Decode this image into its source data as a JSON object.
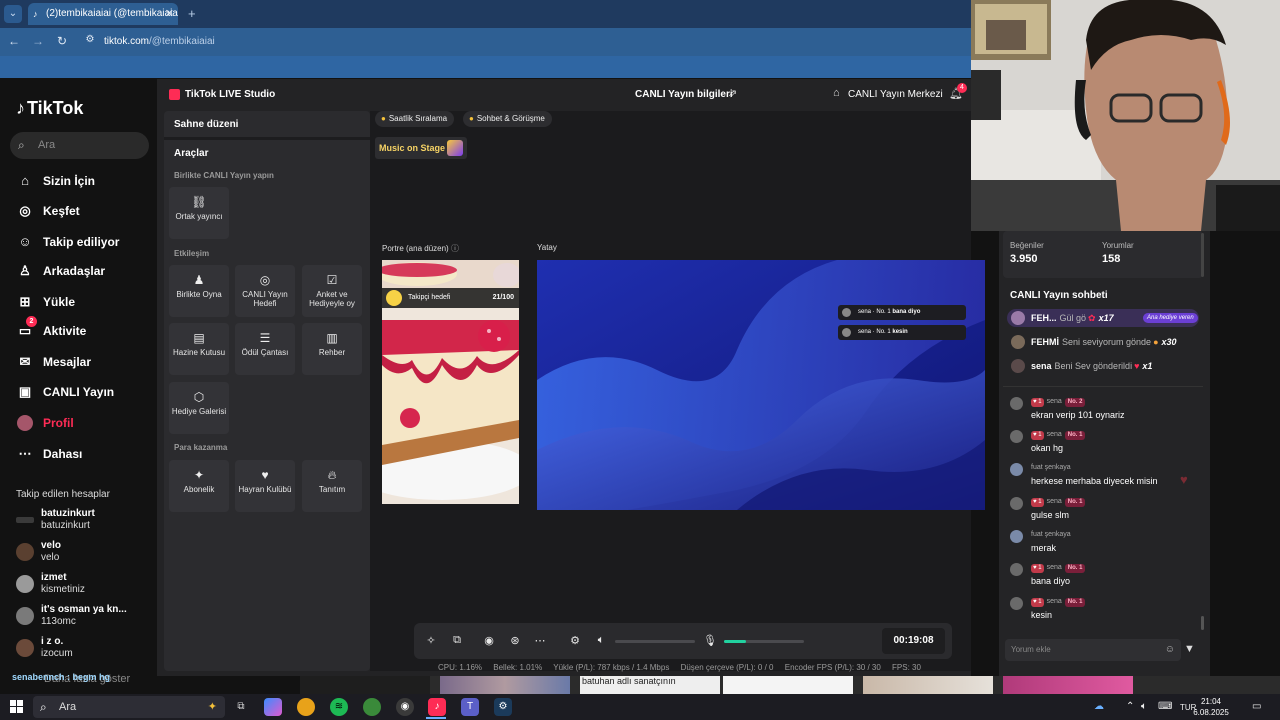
{
  "browser": {
    "tab_title": "(2)tembikaiaiai (@tembikaiaia",
    "tab_close": "✕",
    "new_tab": "+",
    "url_host": "tiktok.com",
    "url_path": "/@tembikaiaiai"
  },
  "tiktok": {
    "logo": "TikTok",
    "search_placeholder": "Ara",
    "nav": [
      {
        "label": "Sizin İçin",
        "icon": "home-icon"
      },
      {
        "label": "Keşfet",
        "icon": "compass-icon"
      },
      {
        "label": "Takip ediliyor",
        "icon": "following-icon"
      },
      {
        "label": "Arkadaşlar",
        "icon": "friends-icon"
      },
      {
        "label": "Yükle",
        "icon": "upload-icon"
      },
      {
        "label": "Aktivite",
        "icon": "activity-icon",
        "badge": "2"
      },
      {
        "label": "Mesajlar",
        "icon": "messages-icon"
      },
      {
        "label": "CANLI Yayın",
        "icon": "live-icon"
      },
      {
        "label": "Profil",
        "icon": "profile-icon",
        "active": true
      },
      {
        "label": "Dahası",
        "icon": "more-icon"
      }
    ],
    "following_header": "Takip edilen hesaplar",
    "following": [
      {
        "name": "batuzinkurt",
        "handle": "batuzinkurt"
      },
      {
        "name": "velo",
        "handle": "velo"
      },
      {
        "name": "izmet",
        "handle": "kismetiniz"
      },
      {
        "name": "it's osman ya kn...",
        "handle": "113omc"
      },
      {
        "name": "i z o.",
        "handle": "izocum"
      }
    ],
    "show_more": "Daha fazla göster",
    "ticker": "senabennch : begm hg"
  },
  "studio": {
    "title": "TikTok LIVE Studio",
    "live_info": "CANLI Yayın bilgileri",
    "live_center": "CANLI Yayın Merkezi",
    "notif_count": "4",
    "scene_title": "Sahne düzeni",
    "tools_title": "Araçlar",
    "sections": {
      "together": "Birlikte CANLI Yayın yapın",
      "engagement": "Etkileşim",
      "earn": "Para kazanma"
    },
    "tools_together": [
      {
        "label": "Ortak yayıncı",
        "icon": "link-icon"
      }
    ],
    "tools_engagement": [
      {
        "label": "Birlikte Oyna",
        "icon": "joystick-icon"
      },
      {
        "label": "CANLI Yayın Hedefi",
        "icon": "target-icon"
      },
      {
        "label": "Anket ve Hediyeyle oy",
        "icon": "poll-icon"
      },
      {
        "label": "Hazine Kutusu",
        "icon": "treasure-icon"
      },
      {
        "label": "Ödül Çantası",
        "icon": "bag-icon"
      },
      {
        "label": "Rehber",
        "icon": "guide-icon"
      },
      {
        "label": "Hediye Galerisi",
        "icon": "gift-gallery-icon"
      }
    ],
    "tools_earn": [
      {
        "label": "Abonelik",
        "icon": "subscription-icon"
      },
      {
        "label": "Hayran Kulübü",
        "icon": "fanclub-icon"
      },
      {
        "label": "Tanıtım",
        "icon": "promote-icon"
      }
    ],
    "pills": [
      "Saatlik Sıralama",
      "Sohbet & Görüşme"
    ],
    "music_on_stage": "Music on Stage",
    "portrait_label": "Portre (ana düzen)",
    "landscape_label": "Yatay",
    "goal_label": "Takipçi hedefi",
    "goal_count": "21/100",
    "overlay_msgs": [
      {
        "user": "sena",
        "badge": "No. 1",
        "text": "bana diyo"
      },
      {
        "user": "sena",
        "badge": "No. 1",
        "text": "kesin"
      }
    ],
    "timer": "00:19:08",
    "mic_level": 0.28,
    "stats": {
      "cpu": "CPU:  1.16%",
      "memory": "Bellek:  1.01%",
      "upload": "Yükle (P/L):  787 kbps / 1.4 Mbps",
      "dropped": "Düşen çerçeve (P/L):  0 / 0",
      "encoder": "Encoder FPS (P/L):  30 / 30",
      "fps": "FPS:  30"
    }
  },
  "chat": {
    "likes_label": "Beğeniler",
    "likes_value": "3.950",
    "comments_label": "Yorumlar",
    "comments_value": "158",
    "title": "CANLI Yayın sohbeti",
    "gifts": [
      {
        "user": "FEH...",
        "text": "Gül gö",
        "count": "x17",
        "tag": "Ana hediye veren"
      },
      {
        "user": "FEHMİ",
        "text": "Seni seviyorum gönde",
        "count": "x30"
      },
      {
        "user": "sena",
        "text": "Beni Sev gönderildi",
        "count": "x1"
      }
    ],
    "messages": [
      {
        "user": "sena",
        "level": "1",
        "badge": "No. 2",
        "text": "ekran verip 101 oynariz"
      },
      {
        "user": "sena",
        "level": "1",
        "badge": "No. 1",
        "text": "okan hg"
      },
      {
        "user": "fuat şenkaya",
        "text": "herkese merhaba diyecek misin"
      },
      {
        "user": "sena",
        "level": "1",
        "badge": "No. 1",
        "text": "gulse slm"
      },
      {
        "user": "fuat şenkaya",
        "text": "merak"
      },
      {
        "user": "sena",
        "level": "1",
        "badge": "No. 1",
        "text": "bana diyo"
      },
      {
        "user": "sena",
        "level": "1",
        "badge": "No. 1",
        "text": "kesin"
      }
    ],
    "comment_placeholder": "Yorum ekle"
  },
  "thumbs": {
    "alt": "batuhan adlı sanatçının"
  },
  "taskbar": {
    "search": "Ara",
    "lang": "TUR",
    "time": "21:04",
    "date": "6.08.2025"
  }
}
